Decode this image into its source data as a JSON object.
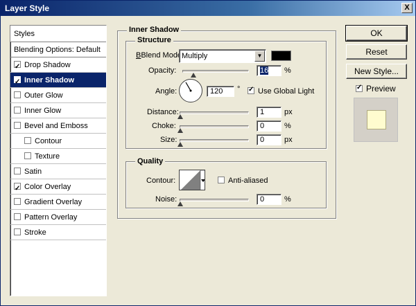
{
  "window": {
    "title": "Layer Style",
    "close_glyph": "X"
  },
  "styles_panel": {
    "header": "Styles",
    "blending_options": "Blending Options: Default",
    "items": [
      {
        "label": "Drop Shadow",
        "checked": true,
        "selected": false,
        "indent": false
      },
      {
        "label": "Inner Shadow",
        "checked": true,
        "selected": true,
        "indent": false
      },
      {
        "label": "Outer Glow",
        "checked": false,
        "selected": false,
        "indent": false
      },
      {
        "label": "Inner Glow",
        "checked": false,
        "selected": false,
        "indent": false
      },
      {
        "label": "Bevel and Emboss",
        "checked": false,
        "selected": false,
        "indent": false
      },
      {
        "label": "Contour",
        "checked": false,
        "selected": false,
        "indent": true
      },
      {
        "label": "Texture",
        "checked": false,
        "selected": false,
        "indent": true
      },
      {
        "label": "Satin",
        "checked": false,
        "selected": false,
        "indent": false
      },
      {
        "label": "Color Overlay",
        "checked": true,
        "selected": false,
        "indent": false
      },
      {
        "label": "Gradient Overlay",
        "checked": false,
        "selected": false,
        "indent": false
      },
      {
        "label": "Pattern Overlay",
        "checked": false,
        "selected": false,
        "indent": false
      },
      {
        "label": "Stroke",
        "checked": false,
        "selected": false,
        "indent": false
      }
    ]
  },
  "inner_shadow": {
    "title": "Inner Shadow",
    "structure": {
      "title": "Structure",
      "blend_mode_label": "Blend Mode:",
      "blend_mode_value": "Multiply",
      "shadow_color": "#000000",
      "opacity_label": "Opacity:",
      "opacity_value": "16",
      "opacity_unit": "%",
      "opacity_fraction": 0.16,
      "angle_label": "Angle:",
      "angle_value": "120",
      "angle_unit": "°",
      "use_global_light_label": "Use Global Light",
      "use_global_light_checked": true,
      "distance_label": "Distance:",
      "distance_value": "1",
      "distance_unit": "px",
      "choke_label": "Choke:",
      "choke_value": "0",
      "choke_unit": "%",
      "size_label": "Size:",
      "size_value": "0",
      "size_unit": "px"
    },
    "quality": {
      "title": "Quality",
      "contour_label": "Contour:",
      "anti_aliased_label": "Anti-aliased",
      "anti_aliased_checked": false,
      "noise_label": "Noise:",
      "noise_value": "0",
      "noise_unit": "%"
    }
  },
  "buttons": {
    "ok": "OK",
    "reset": "Reset",
    "new_style": "New Style...",
    "preview_label": "Preview",
    "preview_checked": true,
    "preview_color": "#fffccf"
  }
}
